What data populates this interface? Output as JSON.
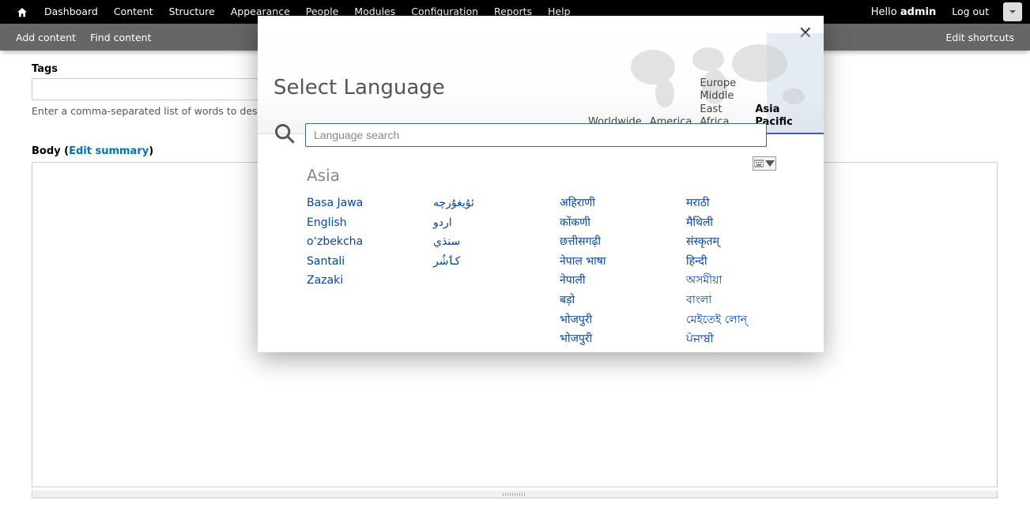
{
  "toolbar": {
    "items": [
      "Dashboard",
      "Content",
      "Structure",
      "Appearance",
      "People",
      "Modules",
      "Configuration",
      "Reports",
      "Help"
    ],
    "greeting_prefix": "Hello ",
    "greeting_user": "admin",
    "logout": "Log out"
  },
  "shortcuts": {
    "left": [
      "Add content",
      "Find content"
    ],
    "right": "Edit shortcuts"
  },
  "page": {
    "tags_label": "Tags",
    "tags_value": "",
    "tags_help": "Enter a comma-separated list of words to descr",
    "body_label_prefix": "Body (",
    "body_summary_link": "Edit summary",
    "body_label_suffix": ")",
    "body_value": ""
  },
  "modal": {
    "title": "Select Language",
    "search_placeholder": "Language search",
    "regions": {
      "worldwide": "Worldwide",
      "america": "America",
      "emea": "Europe Middle East Africa",
      "asia": "Asia Pacific"
    },
    "body_heading": "Asia",
    "columns": [
      [
        "Basa Jawa",
        "English",
        "oʻzbekcha",
        "Santali",
        "Zazaki"
      ],
      [
        "ئۇيغۇرچە",
        "اردو",
        "سنڌي",
        "کٲشُر"
      ],
      [
        "अहिराणी",
        "कोंकणी",
        "छत्तीसगढ़ी",
        "नेपाल भाषा",
        "नेपाली",
        "बड़ो",
        "भोजपुरी",
        "भोजपुरी"
      ],
      [
        "मराठी",
        "मैथिली",
        "संस्कृतम्",
        "हिन्दी",
        "অসমীয়া",
        "বাংলা",
        "মেইতেই লোন্",
        "ਪੰਜਾਬੀ"
      ]
    ]
  }
}
